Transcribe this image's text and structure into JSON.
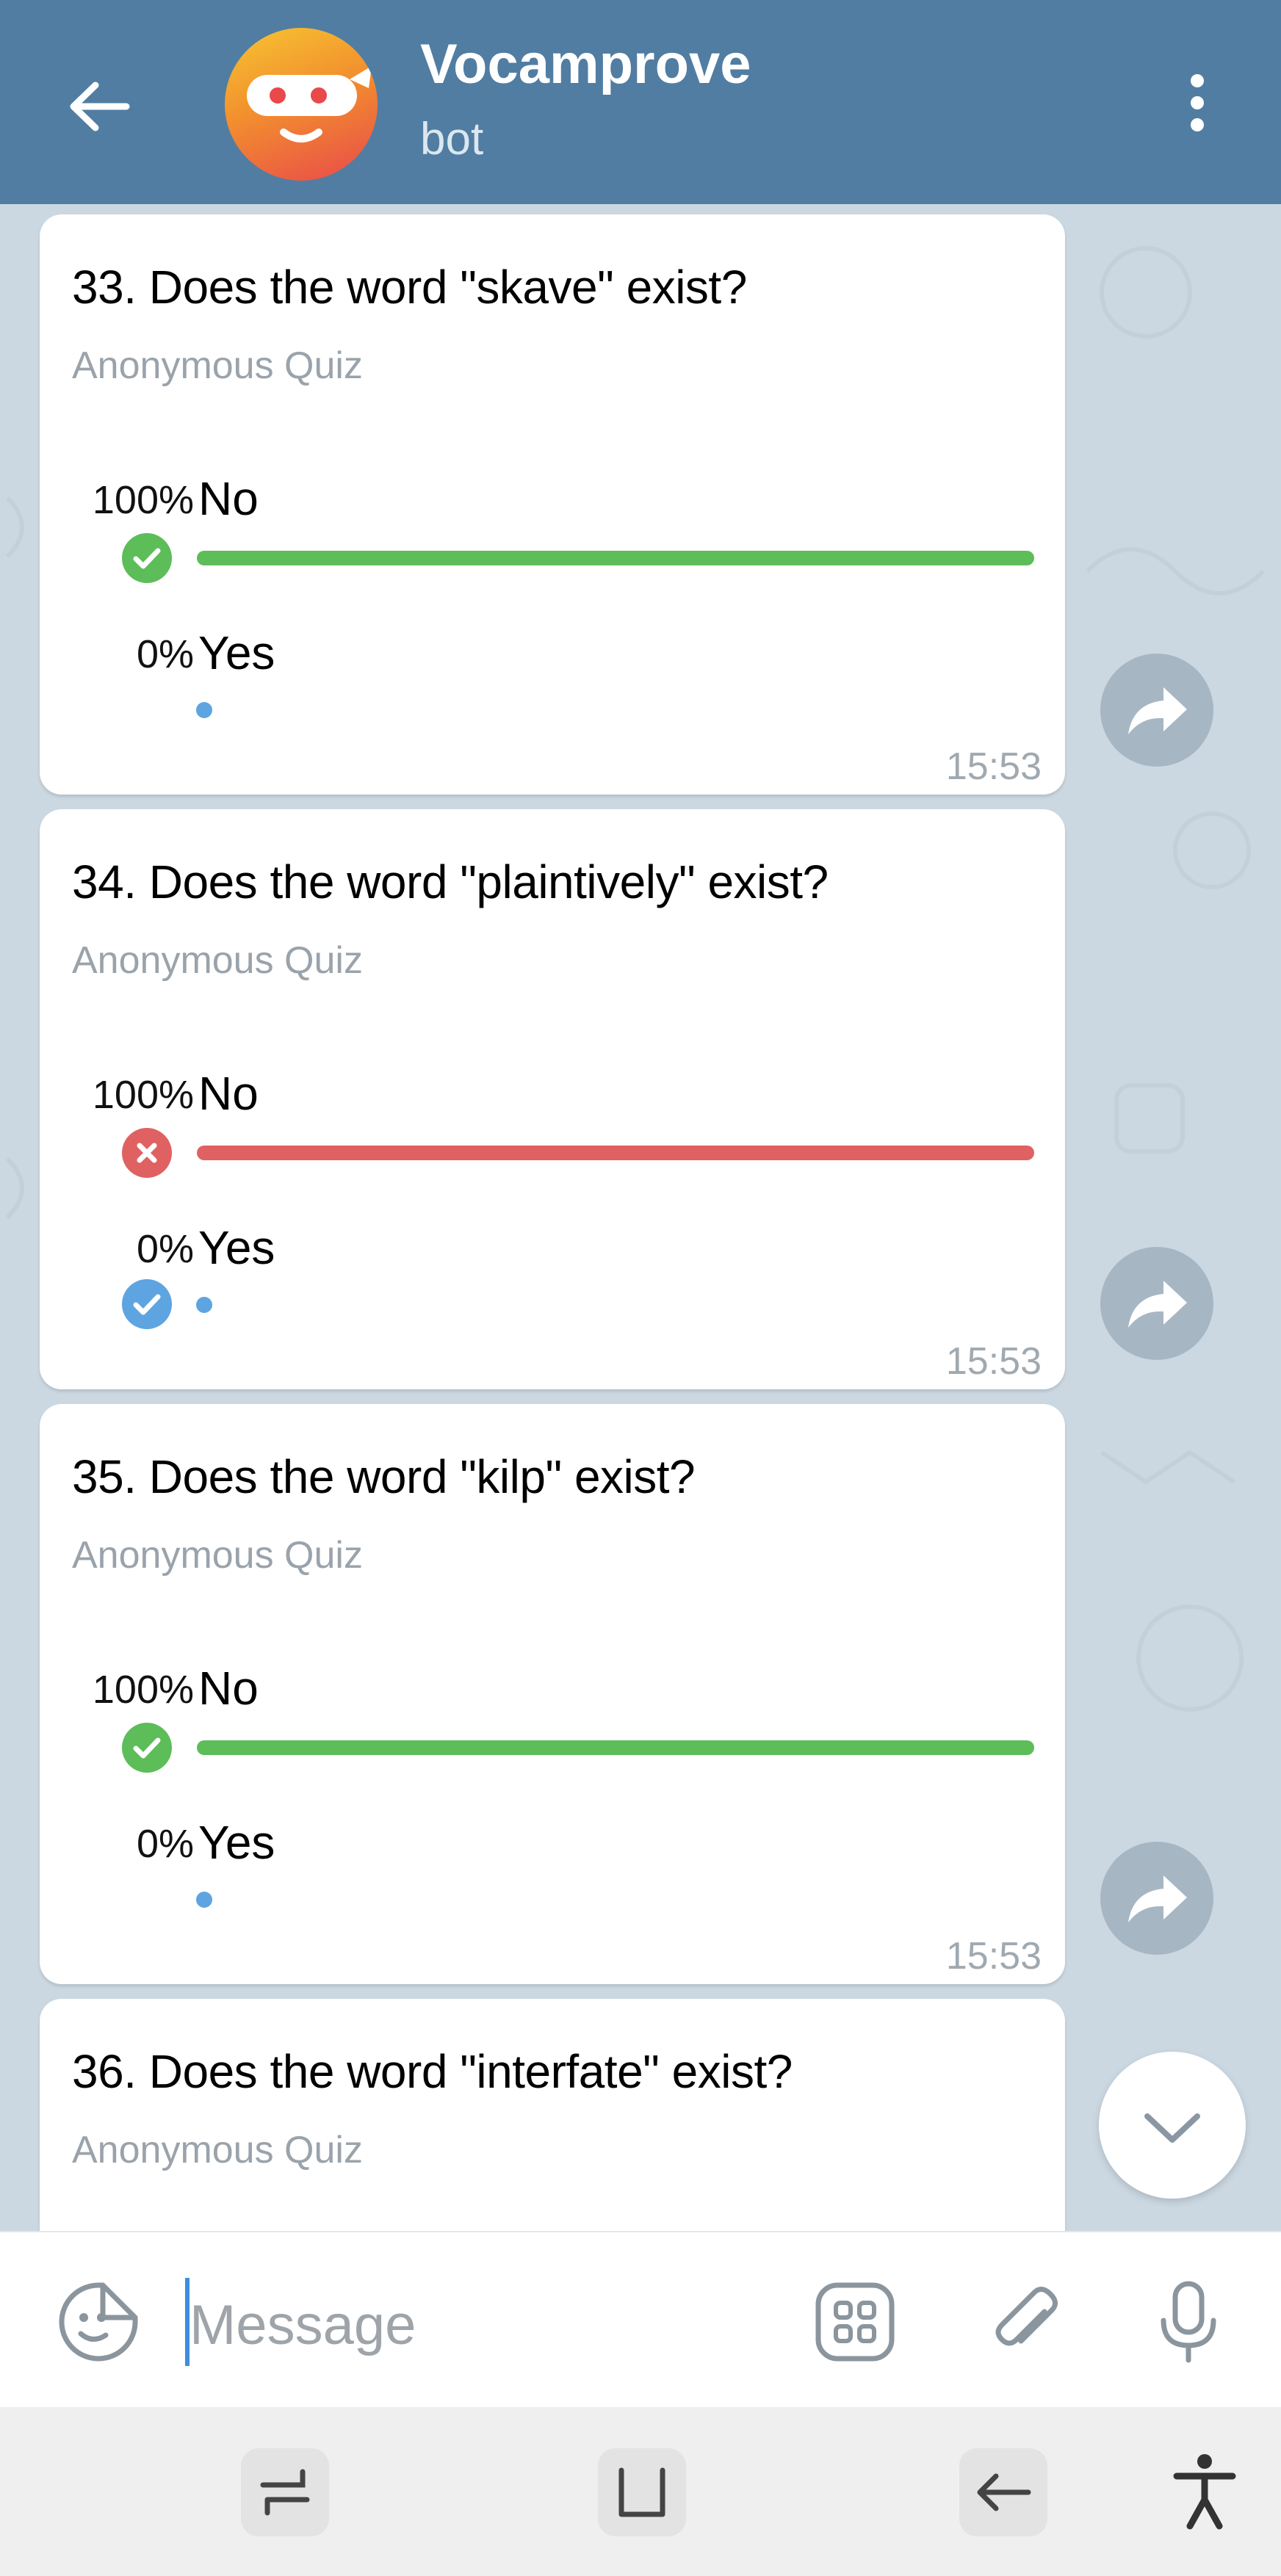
{
  "header": {
    "title": "Vocamprove",
    "subtitle": "bot"
  },
  "quizzes": [
    {
      "question": "33. Does the word \"skave\" exist?",
      "type": "Anonymous Quiz",
      "options": [
        {
          "percent": "100%",
          "label": "No",
          "fraction": 1.0,
          "result": "correct"
        },
        {
          "percent": "0%",
          "label": "Yes",
          "fraction": 0.0
        }
      ],
      "time": "15:53"
    },
    {
      "question": "34. Does the word \"plaintively\" exist?",
      "type": "Anonymous Quiz",
      "options": [
        {
          "percent": "100%",
          "label": "No",
          "fraction": 1.0,
          "result": "wrong"
        },
        {
          "percent": "0%",
          "label": "Yes",
          "fraction": 0.0,
          "result": "correct-answer"
        }
      ],
      "time": "15:53"
    },
    {
      "question": "35. Does the word \"kilp\" exist?",
      "type": "Anonymous Quiz",
      "options": [
        {
          "percent": "100%",
          "label": "No",
          "fraction": 1.0,
          "result": "correct"
        },
        {
          "percent": "0%",
          "label": "Yes",
          "fraction": 0.0
        }
      ],
      "time": "15:53"
    },
    {
      "question": "36. Does the word \"interfate\" exist?",
      "type": "Anonymous Quiz"
    }
  ],
  "input": {
    "placeholder": "Message"
  },
  "icons": {
    "back": "arrow-left-icon",
    "menu": "kebab-menu-icon",
    "share": "share-arrow-icon",
    "scroll_down": "chevron-down-icon",
    "sticker": "sticker-smile-icon",
    "bot_commands": "bot-commands-grid-icon",
    "attach": "paperclip-icon",
    "mic": "microphone-icon",
    "nav_recents": "recent-apps-icon",
    "nav_home": "home-square-icon",
    "nav_back": "nav-back-icon",
    "accessibility": "accessibility-icon"
  },
  "colors": {
    "header": "#517da2",
    "correct": "#5cbd59",
    "wrong": "#e06162",
    "accent": "#5ea4e0"
  }
}
